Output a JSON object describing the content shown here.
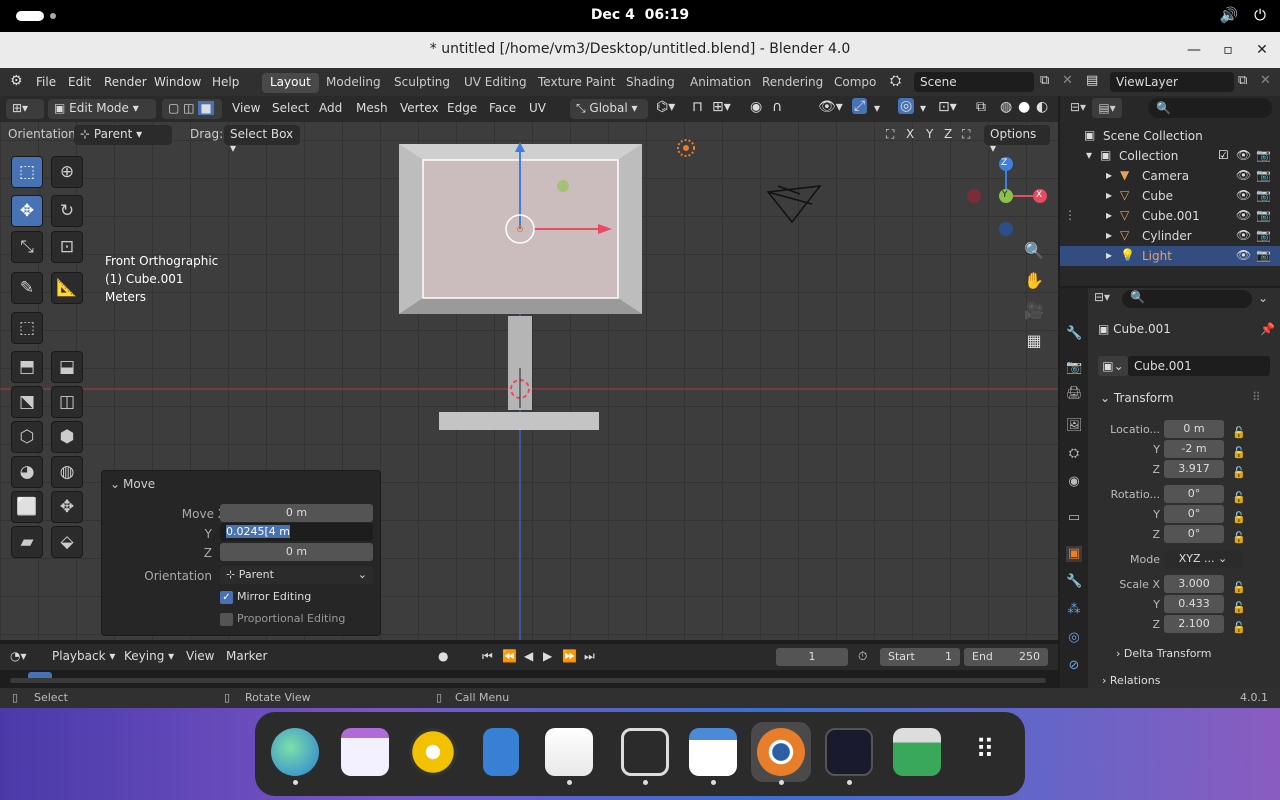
{
  "system": {
    "date": "Dec 4",
    "time": "06:19"
  },
  "window": {
    "title": "* untitled [/home/vm3/Desktop/untitled.blend] - Blender 4.0"
  },
  "menu": {
    "file": "File",
    "edit": "Edit",
    "render": "Render",
    "window": "Window",
    "help": "Help"
  },
  "workspaces": [
    "Layout",
    "Modeling",
    "Sculpting",
    "UV Editing",
    "Texture Paint",
    "Shading",
    "Animation",
    "Rendering",
    "Compo"
  ],
  "scene": {
    "name": "Scene",
    "view_layer": "ViewLayer"
  },
  "header3d": {
    "mode": "Edit Mode",
    "view": "View",
    "select": "Select",
    "add": "Add",
    "mesh": "Mesh",
    "vertex": "Vertex",
    "edge": "Edge",
    "face": "Face",
    "uv": "UV",
    "transform": "Global"
  },
  "options_bar": {
    "orientation_label": "Orientation:",
    "orientation": "Parent",
    "drag_label": "Drag:",
    "drag": "Select Box",
    "options": "Options",
    "axes": [
      "X",
      "Y",
      "Z"
    ]
  },
  "viewport": {
    "view_name": "Front Orthographic",
    "object": "(1) Cube.001",
    "units": "Meters"
  },
  "gizmo": {
    "z": "Z",
    "y": "Y",
    "x": "X"
  },
  "move_panel": {
    "title": "Move",
    "move_x_label": "Move X",
    "move_x": "0 m",
    "y_label": "Y",
    "y": "0.0245[4 m",
    "z_label": "Z",
    "z": "0 m",
    "orientation_label": "Orientation",
    "orientation": "Parent",
    "mirror": "Mirror Editing",
    "proportional": "Proportional Editing"
  },
  "outliner": {
    "root": "Scene Collection",
    "collection": "Collection",
    "items": [
      "Camera",
      "Cube",
      "Cube.001",
      "Cylinder",
      "Light"
    ]
  },
  "properties": {
    "object_name": "Cube.001",
    "data_name": "Cube.001",
    "transform": "Transform",
    "location_label": "Locatio...",
    "loc_x": "0 m",
    "loc_y": "-2 m",
    "loc_z": "3.917",
    "rotation_label": "Rotatio...",
    "rot_x": "0°",
    "rot_y": "0°",
    "rot_z": "0°",
    "mode_label": "Mode",
    "mode": "XYZ ...",
    "scale_label": "Scale X",
    "scale_x": "3.000",
    "scale_y": "0.433",
    "scale_z": "2.100",
    "y_label": "Y",
    "z_label": "Z",
    "delta": "Delta Transform",
    "relations": "Relations"
  },
  "timeline": {
    "playback": "Playback",
    "keying": "Keying",
    "view": "View",
    "marker": "Marker",
    "frame": "1",
    "start_label": "Start",
    "start": "1",
    "end_label": "End",
    "end": "250"
  },
  "status": {
    "select": "Select",
    "rotate": "Rotate View",
    "call_menu": "Call Menu",
    "version": "4.0.1"
  },
  "colors": {
    "accent": "#4772b3",
    "x_axis": "#e84a5f",
    "y_axis": "#8bc34a",
    "z_axis": "#3f7fe0"
  }
}
